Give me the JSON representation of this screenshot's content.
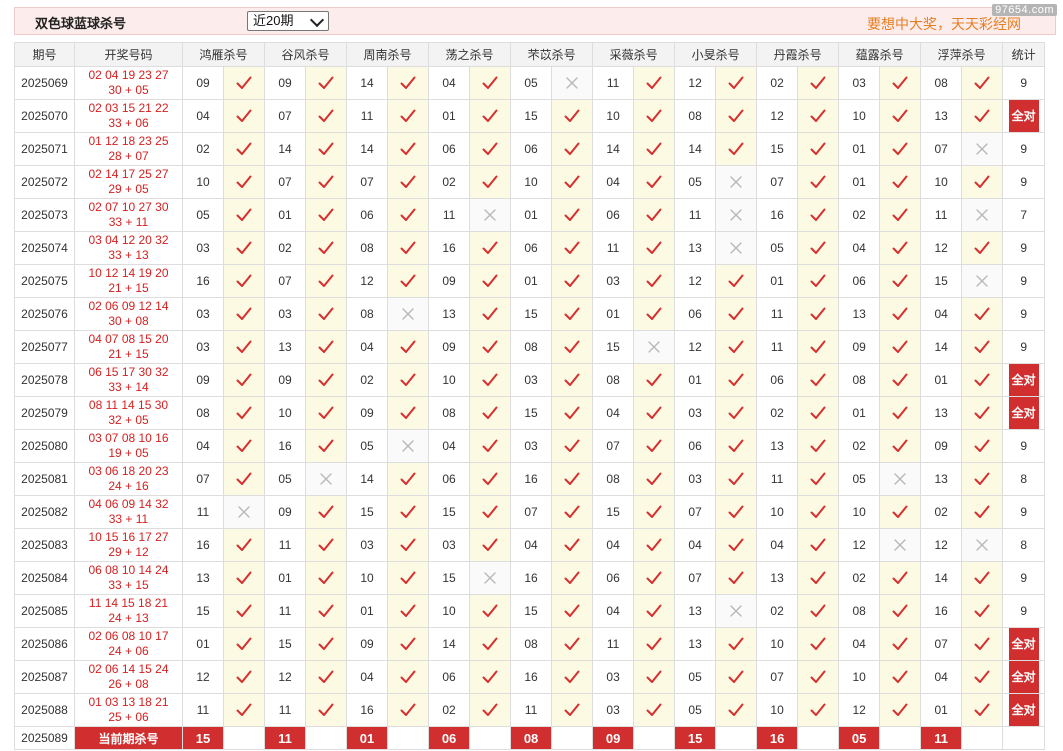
{
  "header": {
    "title": "双色球蓝球杀号",
    "select_value": "近20期",
    "slogan": "要想中大奖，天天彩经网",
    "watermark": "97654.com"
  },
  "columns": {
    "period": "期号",
    "draw": "开奖号码",
    "experts": [
      "鸿雁杀号",
      "谷风杀号",
      "周南杀号",
      "荡之杀号",
      "芣苡杀号",
      "采薇杀号",
      "小旻杀号",
      "丹霞杀号",
      "蕴露杀号",
      "浮萍杀号"
    ],
    "stat": "统计"
  },
  "all_correct_label": "全对",
  "icons": {
    "hit": "check-icon",
    "miss": "cross-icon",
    "hit_color": "#d62f2f",
    "miss_color": "#b8b8b8"
  },
  "rows": [
    {
      "period": "2025069",
      "draw_line1": "02 04 19 23 27",
      "draw_line2": "30 + 05",
      "kills": [
        "09",
        "09",
        "14",
        "04",
        "05",
        "11",
        "12",
        "02",
        "03",
        "08"
      ],
      "hits": [
        1,
        1,
        1,
        1,
        0,
        1,
        1,
        1,
        1,
        1
      ],
      "stat": "9"
    },
    {
      "period": "2025070",
      "draw_line1": "02 03 15 21 22",
      "draw_line2": "33 + 06",
      "kills": [
        "04",
        "07",
        "11",
        "01",
        "15",
        "10",
        "08",
        "12",
        "10",
        "13"
      ],
      "hits": [
        1,
        1,
        1,
        1,
        1,
        1,
        1,
        1,
        1,
        1
      ],
      "stat": "全对"
    },
    {
      "period": "2025071",
      "draw_line1": "01 12 18 23 25",
      "draw_line2": "28 + 07",
      "kills": [
        "02",
        "14",
        "14",
        "06",
        "06",
        "14",
        "14",
        "15",
        "01",
        "07"
      ],
      "hits": [
        1,
        1,
        1,
        1,
        1,
        1,
        1,
        1,
        1,
        0
      ],
      "stat": "9"
    },
    {
      "period": "2025072",
      "draw_line1": "02 14 17 25 27",
      "draw_line2": "29 + 05",
      "kills": [
        "10",
        "07",
        "07",
        "02",
        "10",
        "04",
        "05",
        "07",
        "01",
        "10"
      ],
      "hits": [
        1,
        1,
        1,
        1,
        1,
        1,
        0,
        1,
        1,
        1
      ],
      "stat": "9"
    },
    {
      "period": "2025073",
      "draw_line1": "02 07 10 27 30",
      "draw_line2": "33 + 11",
      "kills": [
        "05",
        "01",
        "06",
        "11",
        "01",
        "06",
        "11",
        "16",
        "02",
        "11"
      ],
      "hits": [
        1,
        1,
        1,
        0,
        1,
        1,
        0,
        1,
        1,
        0
      ],
      "stat": "7"
    },
    {
      "period": "2025074",
      "draw_line1": "03 04 12 20 32",
      "draw_line2": "33 + 13",
      "kills": [
        "03",
        "02",
        "08",
        "16",
        "06",
        "11",
        "13",
        "05",
        "04",
        "12"
      ],
      "hits": [
        1,
        1,
        1,
        1,
        1,
        1,
        0,
        1,
        1,
        1
      ],
      "stat": "9"
    },
    {
      "period": "2025075",
      "draw_line1": "10 12 14 19 20",
      "draw_line2": "21 + 15",
      "kills": [
        "16",
        "07",
        "12",
        "09",
        "01",
        "03",
        "12",
        "01",
        "06",
        "15"
      ],
      "hits": [
        1,
        1,
        1,
        1,
        1,
        1,
        1,
        1,
        1,
        0
      ],
      "stat": "9"
    },
    {
      "period": "2025076",
      "draw_line1": "02 06 09 12 14",
      "draw_line2": "30 + 08",
      "kills": [
        "03",
        "03",
        "08",
        "13",
        "15",
        "01",
        "06",
        "11",
        "13",
        "04"
      ],
      "hits": [
        1,
        1,
        0,
        1,
        1,
        1,
        1,
        1,
        1,
        1
      ],
      "stat": "9"
    },
    {
      "period": "2025077",
      "draw_line1": "04 07 08 15 20",
      "draw_line2": "21 + 15",
      "kills": [
        "03",
        "13",
        "04",
        "09",
        "08",
        "15",
        "12",
        "11",
        "09",
        "14"
      ],
      "hits": [
        1,
        1,
        1,
        1,
        1,
        0,
        1,
        1,
        1,
        1
      ],
      "stat": "9"
    },
    {
      "period": "2025078",
      "draw_line1": "06 15 17 30 32",
      "draw_line2": "33 + 14",
      "kills": [
        "09",
        "09",
        "02",
        "10",
        "03",
        "08",
        "01",
        "06",
        "08",
        "01"
      ],
      "hits": [
        1,
        1,
        1,
        1,
        1,
        1,
        1,
        1,
        1,
        1
      ],
      "stat": "全对"
    },
    {
      "period": "2025079",
      "draw_line1": "08 11 14 15 30",
      "draw_line2": "32 + 05",
      "kills": [
        "08",
        "10",
        "09",
        "08",
        "15",
        "04",
        "03",
        "02",
        "01",
        "13"
      ],
      "hits": [
        1,
        1,
        1,
        1,
        1,
        1,
        1,
        1,
        1,
        1
      ],
      "stat": "全对"
    },
    {
      "period": "2025080",
      "draw_line1": "03 07 08 10 16",
      "draw_line2": "19 + 05",
      "kills": [
        "04",
        "16",
        "05",
        "04",
        "03",
        "07",
        "06",
        "13",
        "02",
        "09"
      ],
      "hits": [
        1,
        1,
        0,
        1,
        1,
        1,
        1,
        1,
        1,
        1
      ],
      "stat": "9"
    },
    {
      "period": "2025081",
      "draw_line1": "03 06 18 20 23",
      "draw_line2": "24 + 16",
      "kills": [
        "07",
        "05",
        "14",
        "06",
        "16",
        "08",
        "03",
        "11",
        "05",
        "13"
      ],
      "hits": [
        1,
        0,
        1,
        1,
        1,
        1,
        1,
        1,
        0,
        1
      ],
      "stat": "8"
    },
    {
      "period": "2025082",
      "draw_line1": "04 06 09 14 32",
      "draw_line2": "33 + 11",
      "kills": [
        "11",
        "09",
        "15",
        "15",
        "07",
        "15",
        "07",
        "10",
        "10",
        "02"
      ],
      "hits": [
        0,
        1,
        1,
        1,
        1,
        1,
        1,
        1,
        1,
        1
      ],
      "stat": "9"
    },
    {
      "period": "2025083",
      "draw_line1": "10 15 16 17 27",
      "draw_line2": "29 + 12",
      "kills": [
        "16",
        "11",
        "03",
        "03",
        "04",
        "04",
        "04",
        "04",
        "12",
        "12"
      ],
      "hits": [
        1,
        1,
        1,
        1,
        1,
        1,
        1,
        1,
        0,
        0
      ],
      "stat": "8"
    },
    {
      "period": "2025084",
      "draw_line1": "06 08 10 14 24",
      "draw_line2": "33 + 15",
      "kills": [
        "13",
        "01",
        "10",
        "15",
        "16",
        "06",
        "07",
        "13",
        "02",
        "14"
      ],
      "hits": [
        1,
        1,
        1,
        0,
        1,
        1,
        1,
        1,
        1,
        1
      ],
      "stat": "9"
    },
    {
      "period": "2025085",
      "draw_line1": "11 14 15 18 21",
      "draw_line2": "24 + 13",
      "kills": [
        "15",
        "11",
        "01",
        "10",
        "15",
        "04",
        "13",
        "02",
        "08",
        "16"
      ],
      "hits": [
        1,
        1,
        1,
        1,
        1,
        1,
        0,
        1,
        1,
        1
      ],
      "stat": "9"
    },
    {
      "period": "2025086",
      "draw_line1": "02 06 08 10 17",
      "draw_line2": "24 + 06",
      "kills": [
        "01",
        "15",
        "09",
        "14",
        "08",
        "11",
        "13",
        "10",
        "04",
        "07"
      ],
      "hits": [
        1,
        1,
        1,
        1,
        1,
        1,
        1,
        1,
        1,
        1
      ],
      "stat": "全对"
    },
    {
      "period": "2025087",
      "draw_line1": "02 06 14 15 24",
      "draw_line2": "26 + 08",
      "kills": [
        "12",
        "12",
        "04",
        "06",
        "16",
        "03",
        "05",
        "07",
        "10",
        "04"
      ],
      "hits": [
        1,
        1,
        1,
        1,
        1,
        1,
        1,
        1,
        1,
        1
      ],
      "stat": "全对"
    },
    {
      "period": "2025088",
      "draw_line1": "01 03 13 18 21",
      "draw_line2": "25 + 06",
      "kills": [
        "11",
        "11",
        "16",
        "02",
        "11",
        "03",
        "05",
        "10",
        "12",
        "01"
      ],
      "hits": [
        1,
        1,
        1,
        1,
        1,
        1,
        1,
        1,
        1,
        1
      ],
      "stat": "全对"
    }
  ],
  "current": {
    "period": "2025089",
    "label": "当前期杀号",
    "kills": [
      "15",
      "11",
      "01",
      "06",
      "08",
      "09",
      "15",
      "16",
      "05",
      "11"
    ]
  }
}
